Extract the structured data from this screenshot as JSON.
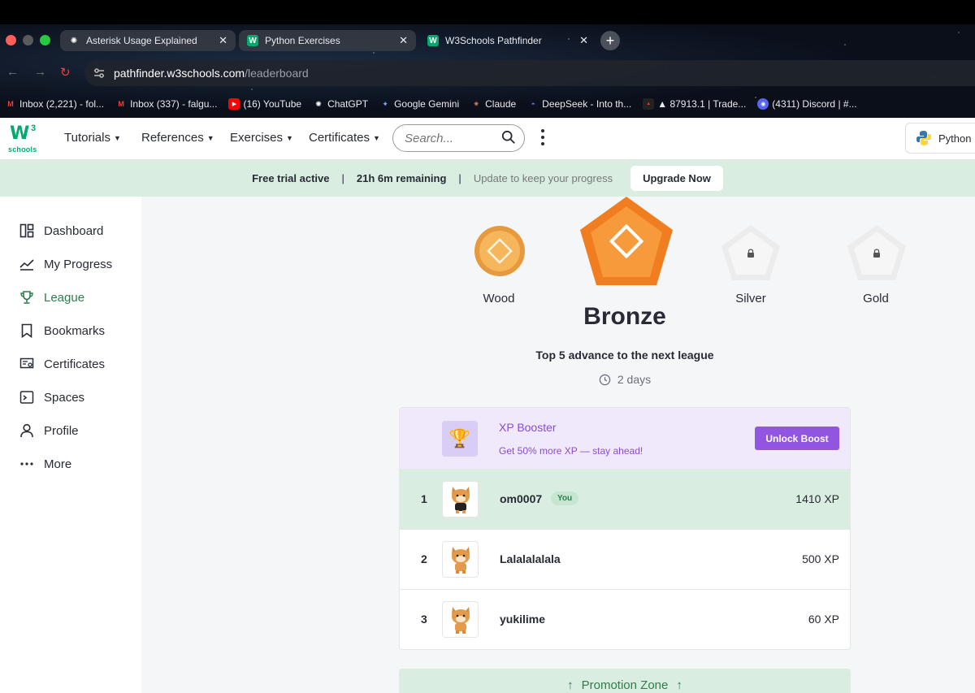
{
  "browser": {
    "tabs": [
      {
        "title": "Asterisk Usage Explained",
        "icon": "chatgpt-icon"
      },
      {
        "title": "Python Exercises",
        "icon": "w3schools-icon"
      },
      {
        "title": "W3Schools Pathfinder",
        "icon": "w3schools-icon"
      }
    ],
    "close_glyph": "✕",
    "new_tab_glyph": "+",
    "url_host": "pathfinder.w3schools.com",
    "url_path": "/leaderboard",
    "bookmarks": [
      {
        "label": "Inbox (2,221) - fol...",
        "icon": "gmail-icon"
      },
      {
        "label": "Inbox (337) - falgu...",
        "icon": "gmail-icon"
      },
      {
        "label": "(16) YouTube",
        "icon": "youtube-icon"
      },
      {
        "label": "ChatGPT",
        "icon": "chatgpt-icon"
      },
      {
        "label": "Google Gemini",
        "icon": "gemini-icon"
      },
      {
        "label": "Claude",
        "icon": "claude-icon"
      },
      {
        "label": "DeepSeek - Into th...",
        "icon": "deepseek-icon"
      },
      {
        "label": "▲ 87913.1 | Trade...",
        "icon": "trade-icon"
      },
      {
        "label": "(4311) Discord | #...",
        "icon": "discord-icon"
      }
    ]
  },
  "site": {
    "logo_w": "W",
    "logo_three": "3",
    "logo_schools": "schools",
    "nav": [
      "Tutorials",
      "References",
      "Exercises",
      "Certificates"
    ],
    "search_placeholder": "Search...",
    "language": "Python",
    "accent": "#04aa6d"
  },
  "banner": {
    "status": "Free trial active",
    "separator": "|",
    "remaining": "21h 6m remaining",
    "note": "Update to keep your progress",
    "cta": "Upgrade Now"
  },
  "sidebar": {
    "items": [
      {
        "label": "Dashboard",
        "icon": "dashboard-icon",
        "active": false
      },
      {
        "label": "My Progress",
        "icon": "progress-icon",
        "active": false
      },
      {
        "label": "League",
        "icon": "trophy-icon",
        "active": true
      },
      {
        "label": "Bookmarks",
        "icon": "bookmark-icon",
        "active": false
      },
      {
        "label": "Certificates",
        "icon": "certificate-icon",
        "active": false
      },
      {
        "label": "Spaces",
        "icon": "terminal-icon",
        "active": false
      },
      {
        "label": "Profile",
        "icon": "user-icon",
        "active": false
      },
      {
        "label": "More",
        "icon": "more-icon",
        "active": false
      }
    ]
  },
  "league": {
    "medals": [
      {
        "label": "Wood",
        "locked": false
      },
      {
        "label": "Silver",
        "locked": true
      },
      {
        "label": "Gold",
        "locked": true
      }
    ],
    "current": "Bronze",
    "advance_text": "Top 5 advance to the next league",
    "time_left": "2 days"
  },
  "booster": {
    "title": "XP Booster",
    "subtitle": "Get 50% more XP — stay ahead!",
    "cta": "Unlock Boost",
    "color": "#9155e0"
  },
  "leaderboard": [
    {
      "rank": "1",
      "name": "om0007",
      "badge": "You",
      "xp": "1410 XP"
    },
    {
      "rank": "2",
      "name": "Lalalalalala",
      "badge": "",
      "xp": "500 XP"
    },
    {
      "rank": "3",
      "name": "yukilime",
      "badge": "",
      "xp": "60 XP"
    }
  ],
  "promotion_zone": "Promotion Zone"
}
